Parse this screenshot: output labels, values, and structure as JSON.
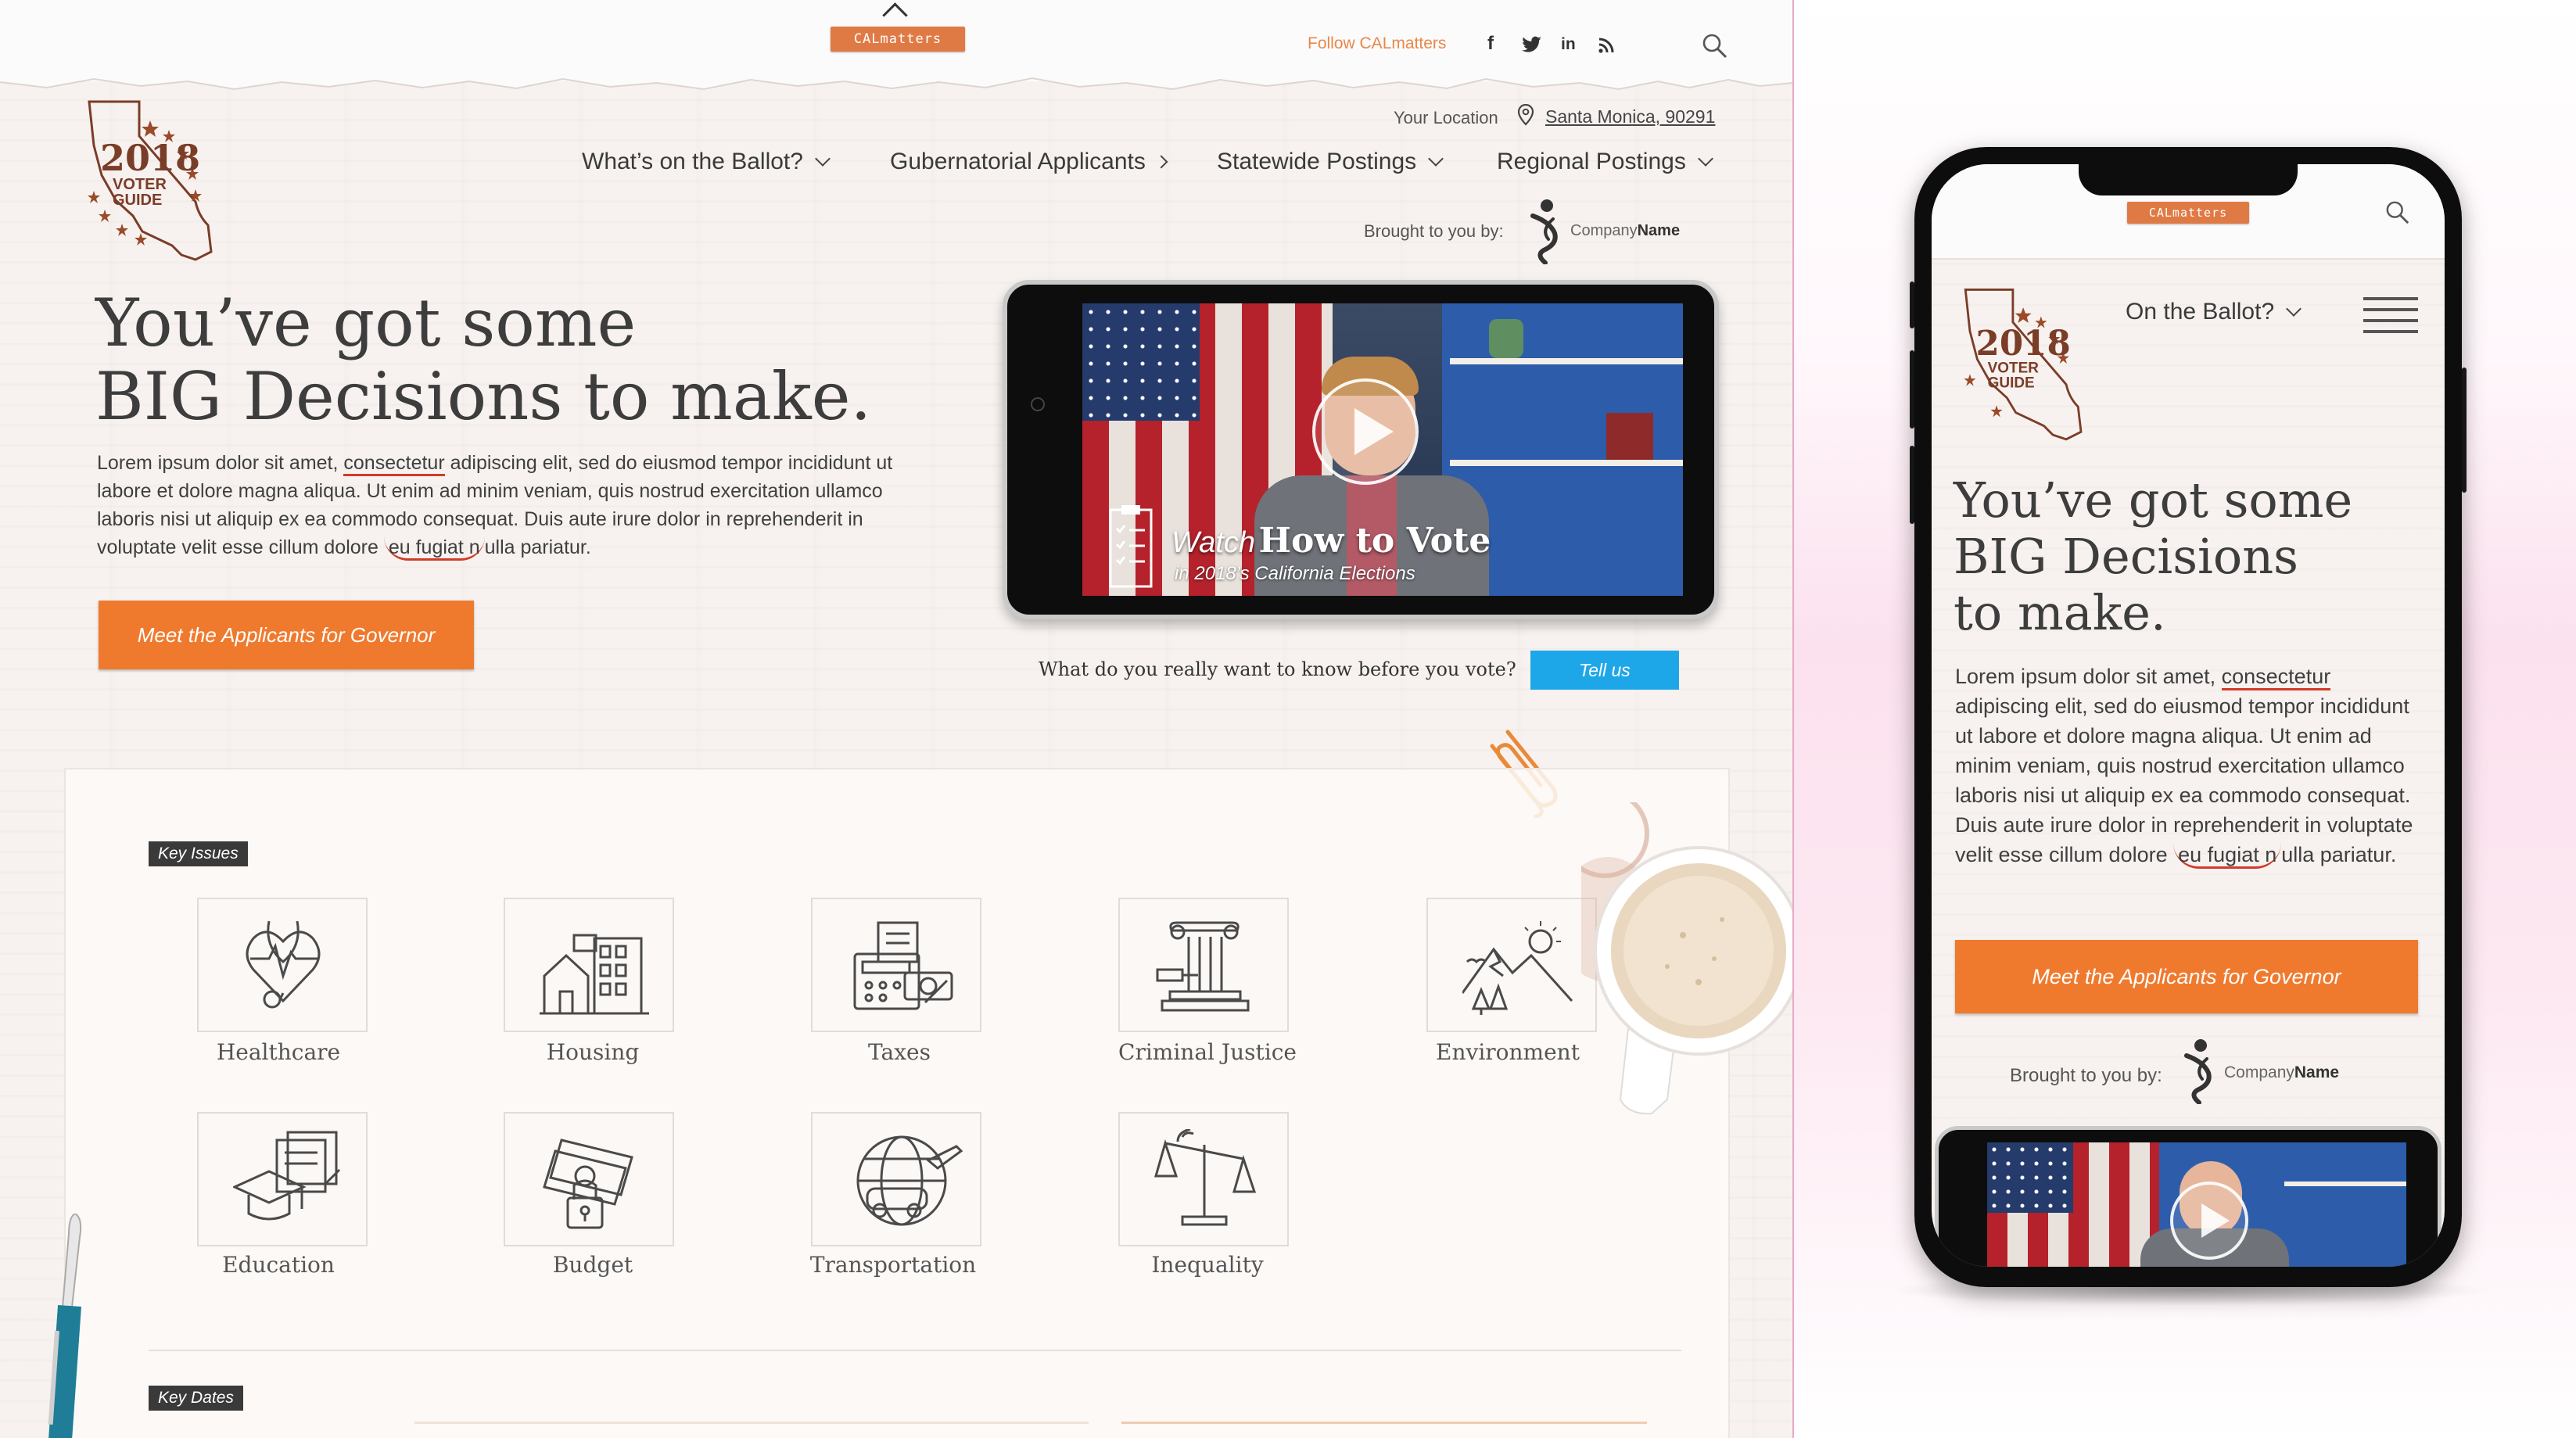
{
  "brand": {
    "name": "CALmatters",
    "accent": "#ef7a2e",
    "tag_color": "#e07a45"
  },
  "topbar": {
    "follow_label": "Follow CALmatters",
    "socials": [
      {
        "icon": "facebook-icon",
        "glyph": "f"
      },
      {
        "icon": "twitter-icon",
        "glyph": "🐦"
      },
      {
        "icon": "linkedin-icon",
        "glyph": "in"
      },
      {
        "icon": "rss-icon",
        "glyph": "◉"
      }
    ],
    "search_icon": "search-icon"
  },
  "guide_logo": {
    "year": "2018",
    "line1": "VOTER",
    "line2": "GUIDE"
  },
  "location": {
    "label": "Your Location",
    "value": "Santa Monica, 90291"
  },
  "nav": [
    {
      "label": "What’s on the Ballot?",
      "chevron": "down"
    },
    {
      "label": "Gubernatorial Applicants",
      "chevron": "right"
    },
    {
      "label": "Statewide Postings",
      "chevron": "down"
    },
    {
      "label": "Regional Postings",
      "chevron": "down"
    }
  ],
  "sponsor": {
    "label": "Brought to you by:",
    "company_light": "Company",
    "company_bold": "Name"
  },
  "hero": {
    "title_line1": "You’ve got some",
    "title_line2": "BIG Decisions to make.",
    "body_pre": "Lorem ipsum dolor sit amet, ",
    "body_underline": "consectetur",
    "body_mid": " adipiscing elit, sed do eiusmod tempor incididunt ut labore et dolore magna aliqua. Ut enim ad minim veniam, quis nostrud exercitation ullamco laboris nisi ut aliquip ex ea commodo consequat. Duis aute irure dolor in reprehenderit in voluptate velit esse cillum dolore ",
    "body_circled": "eu fugiat n",
    "body_post": "ulla pariatur.",
    "cta": "Meet the Applicants for Governor"
  },
  "video": {
    "watch": "Watch",
    "title": "How to Vote",
    "subtitle": "in 2018’s California Elections"
  },
  "question": {
    "text": "What do you really want to know before you vote?",
    "button": "Tell us"
  },
  "key_issues": {
    "tag": "Key Issues",
    "items": [
      {
        "label": "Healthcare",
        "icon": "healthcare-icon"
      },
      {
        "label": "Housing",
        "icon": "housing-icon"
      },
      {
        "label": "Taxes",
        "icon": "taxes-icon"
      },
      {
        "label": "Criminal Justice",
        "icon": "criminal-justice-icon"
      },
      {
        "label": "Environment",
        "icon": "environment-icon"
      },
      {
        "label": "Education",
        "icon": "education-icon"
      },
      {
        "label": "Budget",
        "icon": "budget-icon"
      },
      {
        "label": "Transportation",
        "icon": "transportation-icon"
      },
      {
        "label": "Inequality",
        "icon": "inequality-icon"
      }
    ]
  },
  "key_dates": {
    "tag": "Key Dates"
  },
  "mobile": {
    "nav_label": "On the Ballot?",
    "title_line1": "You’ve got some",
    "title_line2": "BIG Decisions",
    "title_line3": "to make."
  }
}
